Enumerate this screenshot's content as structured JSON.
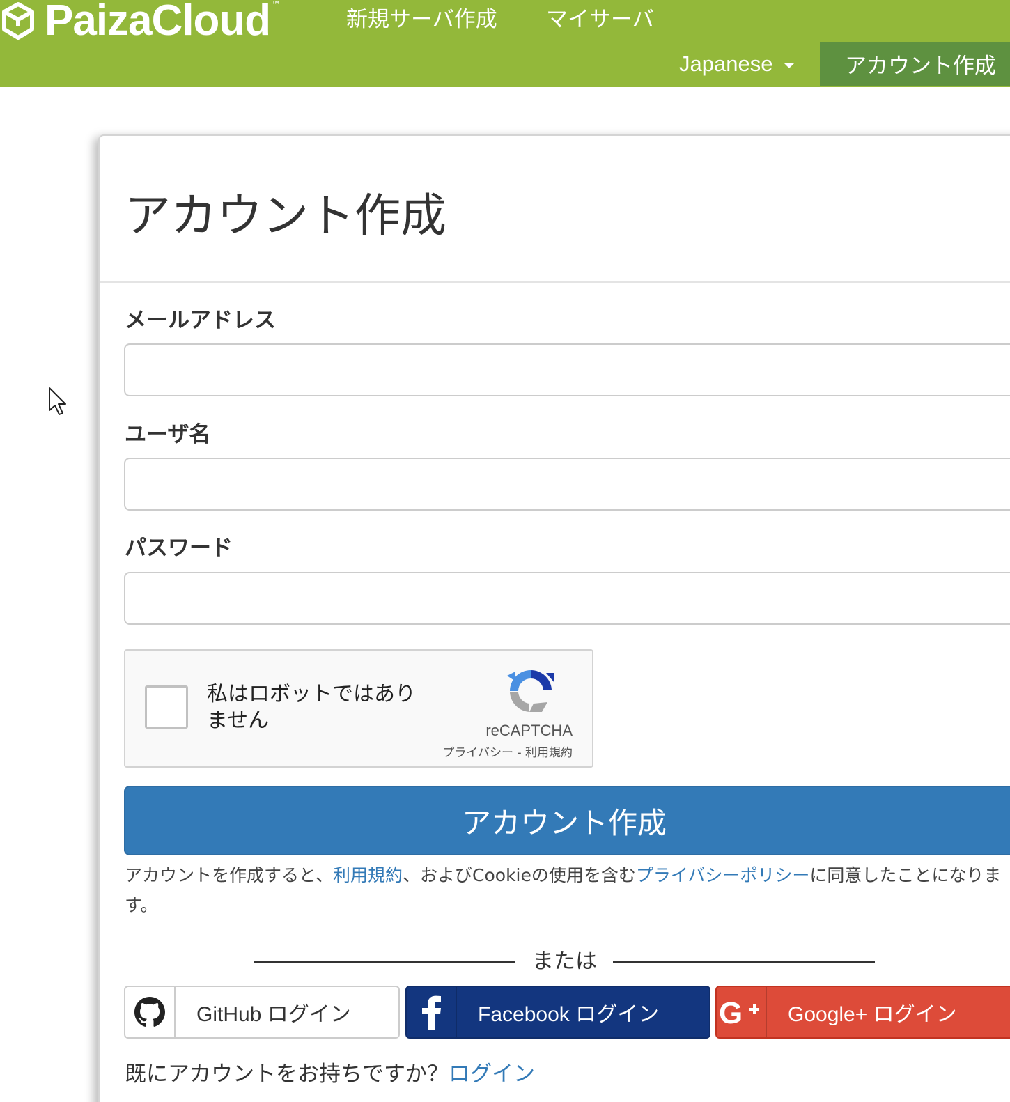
{
  "nav": {
    "brand": "PaizaCloud",
    "brand_tm": "™",
    "links": [
      "新規サーバ作成",
      "マイサーバ"
    ],
    "language": "Japanese",
    "account": "アカウント作成"
  },
  "form": {
    "title": "アカウント作成",
    "email_label": "メールアドレス",
    "username_label": "ユーザ名",
    "password_label": "パスワード",
    "email_value": "",
    "username_value": "",
    "password_value": ""
  },
  "captcha": {
    "label_line1": "私はロボットではあり",
    "label_line2": "ません",
    "brand": "reCAPTCHA",
    "privacy": "プライバシー",
    "separator": " - ",
    "terms": "利用規約"
  },
  "submit_label": "アカウント作成",
  "terms": {
    "prefix": "アカウントを作成すると、",
    "terms_link": "利用規約",
    "middle": "、およびCookieの使用を含む",
    "privacy_link": "プライバシーポリシー",
    "suffix": "に同意したことになります。"
  },
  "divider_text": "または",
  "social": {
    "github": "GitHub ログイン",
    "facebook": "Facebook ログイン",
    "google": "Google+ ログイン"
  },
  "login": {
    "question": "既にアカウントをお持ちですか？",
    "link": "ログイン"
  },
  "colors": {
    "navbar": "#93b83a",
    "navbar_active": "#5e9140",
    "primary": "#337ab7",
    "facebook": "#13367f",
    "google": "#dd4b39"
  }
}
